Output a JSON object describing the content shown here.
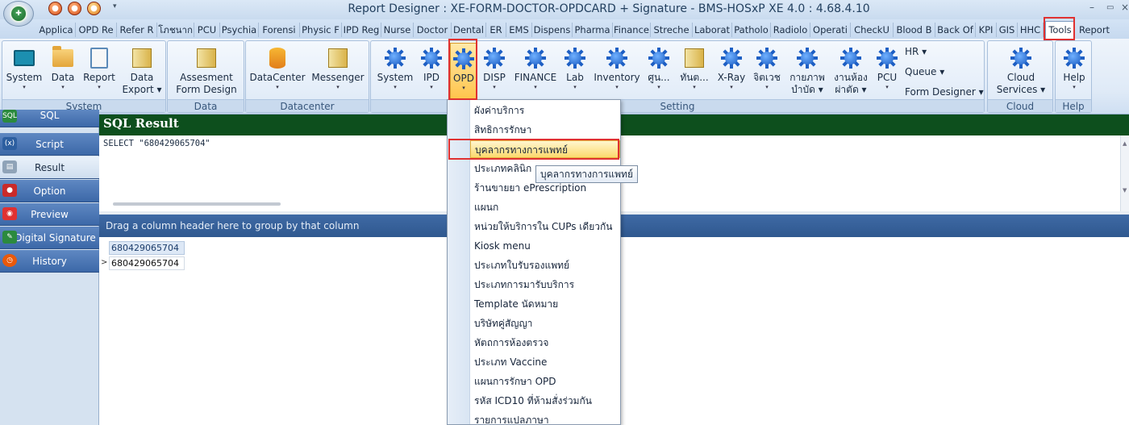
{
  "window": {
    "title": "Report Designer : XE-FORM-DOCTOR-OPDCARD + Signature - BMS-HOSxP XE 4.0 : 4.68.4.10",
    "minimize": "–",
    "restore": "▭",
    "close": "×"
  },
  "quick_access": [
    "●",
    "●",
    "●"
  ],
  "tabs": [
    "Applica",
    "OPD Re",
    "Refer R",
    "โภชนาก",
    "PCU",
    "Psychia",
    "Forensi",
    "Physic F",
    "IPD Reg",
    "Nurse",
    "Doctor",
    "Dental",
    "ER",
    "EMS",
    "Dispens",
    "Pharma",
    "Finance",
    "Streche",
    "Laborat",
    "Patholo",
    "Radiolo",
    "Operati",
    "CheckU",
    "Blood B",
    "Back Of",
    "KPI",
    "GIS",
    "HHC",
    "Tools",
    "Report"
  ],
  "active_tab": "Tools",
  "help_icon_label": "?",
  "ribbon": {
    "system_group": {
      "label": "System",
      "buttons": [
        {
          "label": "System",
          "arrow": "▾"
        },
        {
          "label": "Data",
          "arrow": "▾"
        },
        {
          "label": "Report",
          "arrow": "▾"
        },
        {
          "label": "Data",
          "label2": "Export ▾"
        }
      ]
    },
    "data_group": {
      "label": "Data",
      "buttons": [
        {
          "label": "Assesment",
          "label2": "Form Design"
        }
      ]
    },
    "datacenter_group": {
      "label": "Datacenter",
      "buttons": [
        {
          "label": "DataCenter",
          "arrow": "▾"
        },
        {
          "label": "Messenger",
          "arrow": "▾"
        }
      ]
    },
    "setting_group": {
      "label": "Setting",
      "buttons": [
        {
          "label": "System",
          "arrow": "▾"
        },
        {
          "label": "IPD",
          "arrow": "▾"
        },
        {
          "label": "OPD",
          "arrow": "▾"
        },
        {
          "label": "DISP",
          "arrow": "▾"
        },
        {
          "label": "FINANCE",
          "arrow": "▾"
        },
        {
          "label": "Lab",
          "arrow": "▾"
        },
        {
          "label": "Inventory",
          "arrow": "▾"
        },
        {
          "label": "ศูน...",
          "arrow": "▾"
        },
        {
          "label": "ทันต...",
          "arrow": "▾"
        },
        {
          "label": "X-Ray",
          "arrow": "▾"
        },
        {
          "label": "จิตเวช",
          "arrow": "▾"
        },
        {
          "label": "กายภาพ",
          "label2": "บำบัด ▾"
        },
        {
          "label": "งานห้อง",
          "label2": "ผ่าตัด ▾"
        },
        {
          "label": "PCU",
          "arrow": "▾"
        }
      ],
      "small_buttons": [
        "HR ▾",
        "Queue ▾",
        "Form Designer ▾"
      ]
    },
    "cloud_group": {
      "label": "Cloud Services",
      "buttons": [
        {
          "label": "Cloud",
          "label2": "Services ▾"
        }
      ]
    },
    "help_group": {
      "label": "Help",
      "buttons": [
        {
          "label": "Help",
          "arrow": "▾"
        }
      ]
    }
  },
  "left_nav": {
    "items": [
      {
        "label": "SQL",
        "icon": "SQL"
      },
      {
        "label": "Script",
        "icon": "(x)"
      },
      {
        "label": "Result",
        "icon": "▤"
      },
      {
        "label": "Option",
        "icon": "●"
      },
      {
        "label": "Preview",
        "icon": "◉"
      },
      {
        "label": "Digital Signature",
        "icon": "✎"
      },
      {
        "label": "History",
        "icon": "◷"
      }
    ],
    "selected": "Result"
  },
  "sql_result": {
    "header": "SQL Result",
    "query": "SELECT \"680429065704\""
  },
  "grid": {
    "group_hint": "Drag a column header here to group by that column",
    "column_header": "680429065704",
    "row_indicator": ">",
    "row_value": "680429065704"
  },
  "dropdown_menu": {
    "items": [
      "ผังค่าบริการ",
      "สิทธิการรักษา",
      "บุคลากรทางการแพทย์",
      "ประเภทคลินิก",
      "ร้านขายยา ePrescription",
      "แผนก",
      "หน่วยให้บริการใน CUPs เดียวกัน",
      "Kiosk menu",
      "ประเภทใบรับรองแพทย์",
      "ประเภทการมารับบริการ",
      "Template นัดหมาย",
      "บริษัทคู่สัญญา",
      "หัตถการห้องตรวจ",
      "ประเภท Vaccine",
      "แผนการรักษา OPD",
      "รหัส ICD10 ที่ห้ามสั่งร่วมกัน",
      "รายการแปลภาษา"
    ],
    "hovered_index": 2,
    "tooltip": "บุคลากรทางการแพทย์"
  },
  "colors": {
    "accent": "#e03131",
    "sql_header_bg": "#0d4f1d",
    "nav_blue": "#3c68a8",
    "hover_yellow": "#fcd96d"
  }
}
